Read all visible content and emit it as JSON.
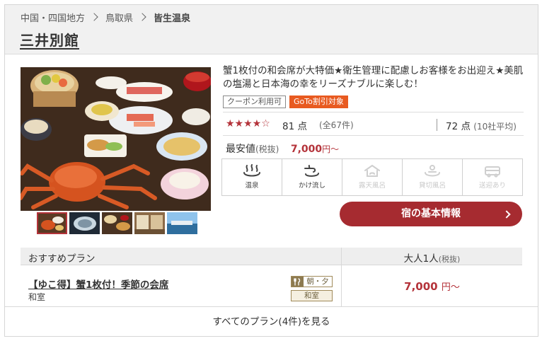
{
  "breadcrumb": {
    "items": [
      "中国・四国地方",
      "鳥取県",
      "皆生温泉"
    ]
  },
  "hotel": {
    "name": "三井別館"
  },
  "description": "蟹1枚付の和会席が大特価★衛生管理に配慮しお客様をお出迎え★美肌の塩湯と日本海の幸をリーズナブルに楽しむ！",
  "badges": {
    "coupon": "クーポン利用可",
    "goto": "GoTo割引対象"
  },
  "rating": {
    "stars_text": "★★★★☆",
    "stars_value": 4,
    "stars_max": 5,
    "score": "81 点",
    "reviews": "(全67件)",
    "average": "72 点",
    "average_note": "(10社平均)"
  },
  "price": {
    "label": "最安値",
    "tax_note": "(税抜)",
    "value": "7,000",
    "suffix": "円～"
  },
  "amenities": [
    {
      "label": "温泉",
      "icon": "hot-spring-icon",
      "active": true
    },
    {
      "label": "かけ流し",
      "icon": "flowing-spring-icon",
      "active": true
    },
    {
      "label": "露天風呂",
      "icon": "open-air-bath-icon",
      "active": false
    },
    {
      "label": "貸切風呂",
      "icon": "private-bath-icon",
      "active": false
    },
    {
      "label": "送迎あり",
      "icon": "shuttle-icon",
      "active": false
    }
  ],
  "info_button": "宿の基本情報",
  "plans": {
    "header_left": "おすすめプラン",
    "header_right": "大人1人",
    "header_right_note": "(税抜)",
    "items": [
      {
        "title": "【ゆこ得】蟹1枚付！季節の会席",
        "room": "和室",
        "meal": "朝・夕",
        "room_tag": "和室",
        "price": "7,000",
        "price_suffix": "円～"
      }
    ]
  },
  "all_plans_link": "すべてのプラン(4件)を見る",
  "colors": {
    "accent": "#a62b30",
    "price": "#b4333a",
    "goto_badge": "#e85a20",
    "header_bg": "#f1f1f1"
  }
}
